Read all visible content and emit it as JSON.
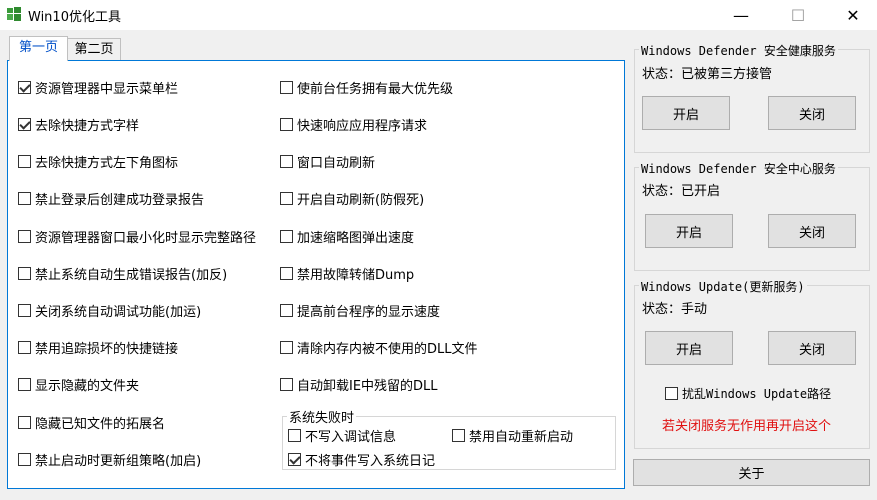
{
  "window": {
    "title": "Win10优化工具",
    "minimize_glyph": "—",
    "maximize_glyph": "☐",
    "close_glyph": "✕"
  },
  "tabs": [
    {
      "label": "第一页",
      "active": true
    },
    {
      "label": "第二页",
      "active": false
    }
  ],
  "left_options": [
    {
      "label": "资源管理器中显示菜单栏",
      "checked": true
    },
    {
      "label": "去除快捷方式字样",
      "checked": true
    },
    {
      "label": "去除快捷方式左下角图标",
      "checked": false
    },
    {
      "label": "禁止登录后创建成功登录报告",
      "checked": false
    },
    {
      "label": "资源管理器窗口最小化时显示完整路径",
      "checked": false
    },
    {
      "label": "禁止系统自动生成错误报告(加反)",
      "checked": false
    },
    {
      "label": "关闭系统自动调试功能(加运)",
      "checked": false
    },
    {
      "label": "禁用追踪损坏的快捷链接",
      "checked": false
    },
    {
      "label": "显示隐藏的文件夹",
      "checked": false
    },
    {
      "label": "隐藏已知文件的拓展名",
      "checked": false
    },
    {
      "label": "禁止启动时更新组策略(加启)",
      "checked": false
    }
  ],
  "right_options": [
    {
      "label": "使前台任务拥有最大优先级",
      "checked": false
    },
    {
      "label": "快速响应应用程序请求",
      "checked": false
    },
    {
      "label": "窗口自动刷新",
      "checked": false
    },
    {
      "label": "开启自动刷新(防假死)",
      "checked": false
    },
    {
      "label": "加速缩略图弹出速度",
      "checked": false
    },
    {
      "label": "禁用故障转储Dump",
      "checked": false
    },
    {
      "label": "提高前台程序的显示速度",
      "checked": false
    },
    {
      "label": "清除内存内被不使用的DLL文件",
      "checked": false
    },
    {
      "label": "自动卸载IE中残留的DLL",
      "checked": false
    }
  ],
  "system_failure": {
    "title": "系统失败时",
    "options": [
      {
        "label": "不写入调试信息",
        "checked": false
      },
      {
        "label": "禁用自动重新启动",
        "checked": false
      },
      {
        "label": "不将事件写入系统日记",
        "checked": true
      }
    ]
  },
  "services": [
    {
      "title": "Windows Defender 安全健康服务",
      "status": "状态：已被第三方接管",
      "open_label": "开启",
      "close_label": "关闭"
    },
    {
      "title": "Windows Defender 安全中心服务",
      "status": "状态：已开启",
      "open_label": "开启",
      "close_label": "关闭"
    },
    {
      "title": "Windows Update(更新服务)",
      "status": "状态：手动",
      "open_label": "开启",
      "close_label": "关闭"
    }
  ],
  "update_path": {
    "label": "扰乱Windows Update路径",
    "checked": false
  },
  "warning_text": "若关闭服务无作用再开启这个",
  "about_label": "关于",
  "colors": {
    "accent": "#0078d7",
    "warning": "#e01010"
  }
}
